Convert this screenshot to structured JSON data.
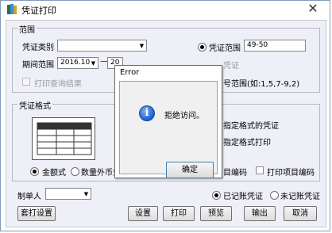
{
  "window": {
    "title": "凭证打印"
  },
  "range_group": {
    "label": "范围",
    "voucher_type_label": "凭证类别",
    "voucher_type_value": "",
    "period_label": "期间范围",
    "period_from": "2016.10",
    "period_to": "20",
    "voucher_range_radio": "凭证范围",
    "voucher_range_value": "49-50",
    "partial_voucher": "凭证",
    "print_query_results": "打印查询结果",
    "number_range_hint": "号范围(如:1,5,7-9,2)"
  },
  "format_group": {
    "label": "凭证格式",
    "specified_format_voucher": "指定格式的凭证",
    "specified_format_print": "指定格式打印",
    "amount_style": "金额式",
    "quantity_foreign_style": "数量外币式",
    "print_item_code_partial": "目编码",
    "print_item_code": "打印项目编码"
  },
  "maker_label": "制单人",
  "maker_value": "",
  "posted_radio": "已记账凭证",
  "unposted_radio": "未记账凭证",
  "buttons": {
    "template_setup": "套打设置",
    "setup": "设置",
    "print": "打印",
    "preview": "预览",
    "export": "输出",
    "cancel": "取消"
  },
  "dialog": {
    "title": "Error",
    "message": "拒绝访问。",
    "ok": "确定"
  },
  "icons": [
    "app-book-icon",
    "close-icon",
    "dropdown-arrow-icon",
    "info-icon"
  ]
}
